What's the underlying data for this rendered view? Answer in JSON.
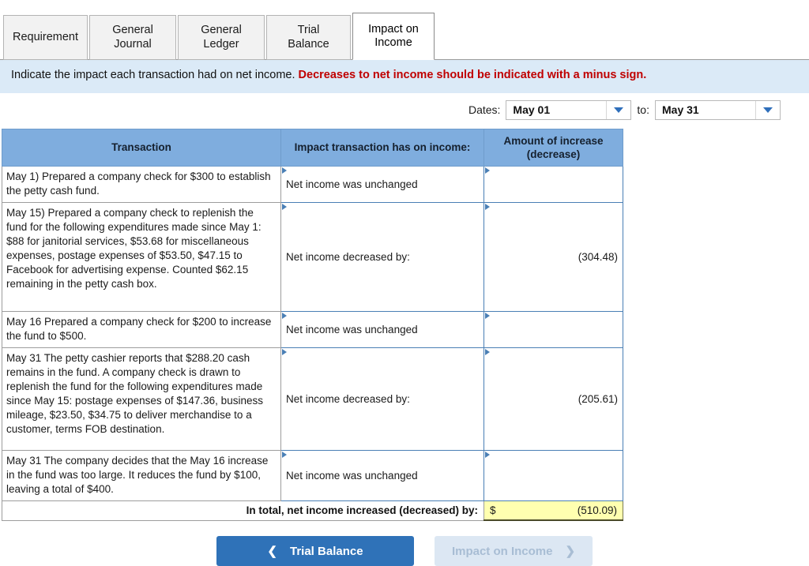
{
  "tabs": [
    {
      "label": "Requirement",
      "active": false
    },
    {
      "label": "General\nJournal",
      "active": false
    },
    {
      "label": "General\nLedger",
      "active": false
    },
    {
      "label": "Trial Balance",
      "active": false
    },
    {
      "label": "Impact on\nIncome",
      "active": true
    }
  ],
  "instructions": {
    "normal": "Indicate the impact each transaction had on net income.",
    "warning": "Decreases to net income should be indicated with a minus sign."
  },
  "dates": {
    "label": "Dates:",
    "to_label": "to:",
    "from_value": "May 01",
    "to_value": "May 31",
    "arrow_icon": "chevron-down-icon"
  },
  "table": {
    "headers": [
      "Transaction",
      "Impact transaction has on income:",
      "Amount of increase (decrease)"
    ],
    "rows": [
      {
        "description": "May 1) Prepared a company check for $300 to establish the petty cash fund.",
        "impact": "Net income was unchanged",
        "amount": ""
      },
      {
        "description": "May 15) Prepared a company check to replenish the fund for the following expenditures made since May 1: $88 for janitorial services, $53.68 for miscellaneous expenses, postage expenses of $53.50, $47.15 to Facebook for advertising expense. Counted $62.15 remaining in the petty cash box.",
        "impact": "Net income decreased by:",
        "amount": "(304.48)"
      },
      {
        "description": "May 16 Prepared a company check for $200 to increase the fund to $500.",
        "impact": "Net income was unchanged",
        "amount": ""
      },
      {
        "description": "May 31 The petty cashier reports that $288.20 cash remains in the fund. A company check is drawn to replenish the fund for the following expenditures made since May 15: postage expenses of $147.36, business mileage, $23.50, $34.75 to deliver merchandise to a customer, terms FOB destination.",
        "impact": "Net income decreased by:",
        "amount": "(205.61)"
      },
      {
        "description": "May 31 The company decides that the May 16 increase in the fund was too large. It reduces the fund by $100, leaving a total of $400.",
        "impact": "Net income was unchanged",
        "amount": ""
      }
    ],
    "total": {
      "label": "In total, net income increased (decreased) by:",
      "currency": "$",
      "value": "(510.09)"
    }
  },
  "footer": {
    "prev_label": "Trial Balance",
    "prev_icon": "chevron-left-icon",
    "next_label": "Impact on Income",
    "next_icon": "chevron-right-icon"
  },
  "colors": {
    "header_blue": "#7fadde",
    "instruction_blue": "#dbeaf7",
    "warning_red": "#c00000",
    "input_border_blue": "#4a7fb5",
    "total_yellow": "#ffffb0",
    "button_blue": "#2f72b8",
    "button_disabled": "#dce7f3"
  }
}
